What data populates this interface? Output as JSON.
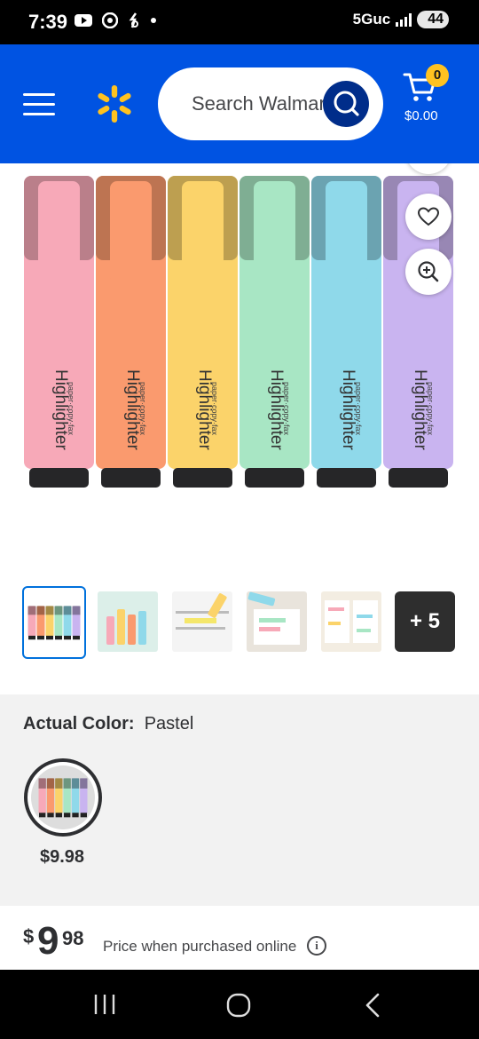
{
  "status_bar": {
    "time": "7:39",
    "icons": [
      "youtube-icon",
      "chrome-icon",
      "notification-icon",
      "dot-icon"
    ],
    "network": "5Guc",
    "battery": "44"
  },
  "header": {
    "search_placeholder": "Search Walmart",
    "cart_count": "0",
    "cart_total": "$0.00",
    "brand_color": "#0053e2",
    "spark_color": "#ffc220"
  },
  "product": {
    "image_caption": "Highlighter",
    "image_subcaption": "paper·copy·fax",
    "pen_colors": [
      "#f7a9b8",
      "#fa9a6e",
      "#fbd36a",
      "#a8e6c4",
      "#8fd9ea",
      "#c9b4f0"
    ],
    "thumbnails_more": "+ 5"
  },
  "variant": {
    "label": "Actual Color:",
    "value": "Pastel",
    "swatch_price": "$9.98"
  },
  "price": {
    "currency": "$",
    "dollars": "9",
    "cents": "98",
    "note": "Price when purchased online",
    "info_icon": "i"
  }
}
